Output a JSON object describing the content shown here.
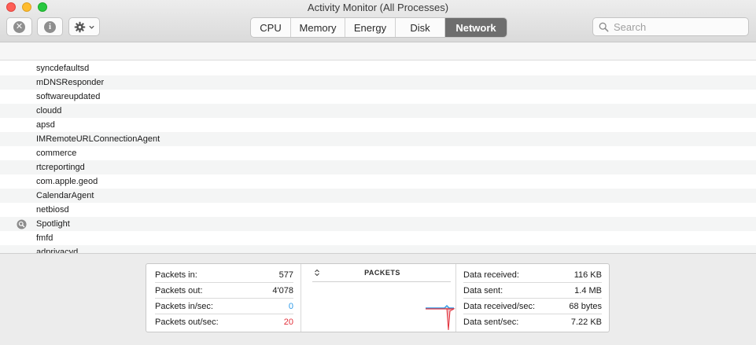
{
  "window": {
    "title": "Activity Monitor (All Processes)"
  },
  "toolbar": {
    "stop_icon": "x-circle-icon",
    "info_icon": "info-circle-icon",
    "gear_icon": "gear-icon",
    "stop_glyph": "✕",
    "info_glyph": "i",
    "tabs": [
      {
        "label": "CPU",
        "active": false
      },
      {
        "label": "Memory",
        "active": false
      },
      {
        "label": "Energy",
        "active": false
      },
      {
        "label": "Disk",
        "active": false
      },
      {
        "label": "Network",
        "active": true
      }
    ],
    "search_placeholder": "Search"
  },
  "processes": [
    {
      "name": "syncdefaultsd",
      "icon": ""
    },
    {
      "name": "mDNSResponder",
      "icon": ""
    },
    {
      "name": "softwareupdated",
      "icon": ""
    },
    {
      "name": "cloudd",
      "icon": ""
    },
    {
      "name": "apsd",
      "icon": ""
    },
    {
      "name": "IMRemoteURLConnectionAgent",
      "icon": ""
    },
    {
      "name": "commerce",
      "icon": ""
    },
    {
      "name": "rtcreportingd",
      "icon": ""
    },
    {
      "name": "com.apple.geod",
      "icon": ""
    },
    {
      "name": "CalendarAgent",
      "icon": ""
    },
    {
      "name": "netbiosd",
      "icon": ""
    },
    {
      "name": "Spotlight",
      "icon": "spotlight-icon"
    },
    {
      "name": "fmfd",
      "icon": ""
    },
    {
      "name": "adprivacyd",
      "icon": ""
    }
  ],
  "summary": {
    "left": [
      {
        "label": "Packets in:",
        "value": "577",
        "tone": ""
      },
      {
        "label": "Packets out:",
        "value": "4'078",
        "tone": ""
      },
      {
        "label": "Packets in/sec:",
        "value": "0",
        "tone": "blue"
      },
      {
        "label": "Packets out/sec:",
        "value": "20",
        "tone": "red"
      }
    ],
    "graph": {
      "title": "PACKETS",
      "selector_icon": "up-down-chevron-icon"
    },
    "right": [
      {
        "label": "Data received:",
        "value": "116 KB"
      },
      {
        "label": "Data sent:",
        "value": "1.4 MB"
      },
      {
        "label": "Data received/sec:",
        "value": "68 bytes"
      },
      {
        "label": "Data sent/sec:",
        "value": "7.22 KB"
      }
    ]
  },
  "colors": {
    "packets_in": "#2e9ae8",
    "packets_out": "#e2303a",
    "active_tab": "#6e6e6e"
  }
}
